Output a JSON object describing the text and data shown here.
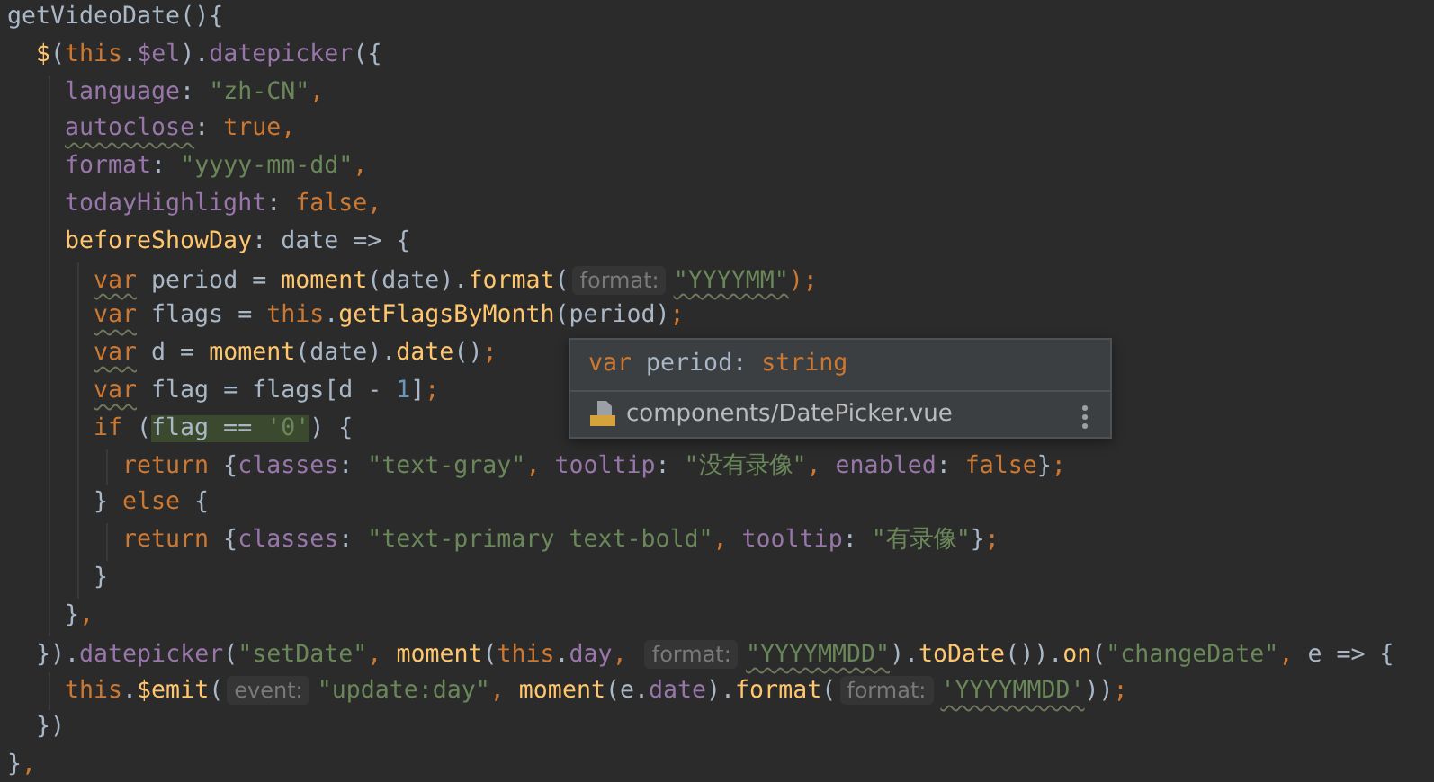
{
  "editor": {
    "lines": [
      {
        "tokens": [
          {
            "text": "getVideoDate(){",
            "kind": "plain"
          }
        ]
      },
      {
        "tokens": [
          {
            "text": "  $",
            "kind": "func"
          },
          {
            "text": "(",
            "kind": "plain"
          },
          {
            "text": "this",
            "kind": "keyword"
          },
          {
            "text": ".",
            "kind": "plain"
          },
          {
            "text": "$el",
            "kind": "prop"
          },
          {
            "text": ").",
            "kind": "plain"
          },
          {
            "text": "datepicker",
            "kind": "prop"
          },
          {
            "text": "({",
            "kind": "plain"
          }
        ]
      },
      {
        "tokens": [
          {
            "text": "    language",
            "kind": "prop"
          },
          {
            "text": ": ",
            "kind": "plain"
          },
          {
            "text": "\"zh-CN\"",
            "kind": "string"
          },
          {
            "text": ",",
            "kind": "separator"
          }
        ]
      },
      {
        "tokens": [
          {
            "text": "    autoclose",
            "kind": "prop-warned"
          },
          {
            "text": ": ",
            "kind": "plain"
          },
          {
            "text": "true",
            "kind": "keyword"
          },
          {
            "text": ",",
            "kind": "separator"
          }
        ]
      },
      {
        "tokens": [
          {
            "text": "    format",
            "kind": "prop"
          },
          {
            "text": ": ",
            "kind": "plain"
          },
          {
            "text": "\"yyyy-mm-dd\"",
            "kind": "string"
          },
          {
            "text": ",",
            "kind": "separator"
          }
        ]
      },
      {
        "tokens": [
          {
            "text": "    todayHighlight",
            "kind": "prop"
          },
          {
            "text": ": ",
            "kind": "plain"
          },
          {
            "text": "false",
            "kind": "keyword"
          },
          {
            "text": ",",
            "kind": "separator"
          }
        ]
      },
      {
        "tokens": [
          {
            "text": "    beforeShowDay",
            "kind": "func"
          },
          {
            "text": ": date => {",
            "kind": "plain"
          }
        ]
      },
      {
        "tokens": [
          {
            "text": "      var",
            "kind": "keyword-warned"
          },
          {
            "text": " period = ",
            "kind": "plain"
          },
          {
            "text": "moment",
            "kind": "func"
          },
          {
            "text": "(date).",
            "kind": "plain"
          },
          {
            "text": "format",
            "kind": "func"
          },
          {
            "text": "(",
            "kind": "plain"
          },
          {
            "text": "format:",
            "kind": "hint"
          },
          {
            "text": "\"YYYYMM\"",
            "kind": "string-warned"
          },
          {
            "text": ");",
            "kind": "separator"
          }
        ]
      },
      {
        "tokens": [
          {
            "text": "      var",
            "kind": "keyword-warned"
          },
          {
            "text": " flags = ",
            "kind": "plain"
          },
          {
            "text": "this",
            "kind": "keyword"
          },
          {
            "text": ".",
            "kind": "plain"
          },
          {
            "text": "getFlagsByMonth",
            "kind": "func"
          },
          {
            "text": "(period)",
            "kind": "plain"
          },
          {
            "text": ";",
            "kind": "separator"
          }
        ]
      },
      {
        "tokens": [
          {
            "text": "      var",
            "kind": "keyword-warned"
          },
          {
            "text": " d = ",
            "kind": "plain"
          },
          {
            "text": "moment",
            "kind": "func"
          },
          {
            "text": "(date).",
            "kind": "plain"
          },
          {
            "text": "date",
            "kind": "func"
          },
          {
            "text": "()",
            "kind": "plain"
          },
          {
            "text": ";",
            "kind": "separator"
          }
        ]
      },
      {
        "tokens": [
          {
            "text": "      var",
            "kind": "keyword-warned"
          },
          {
            "text": " flag = flags[d - ",
            "kind": "plain"
          },
          {
            "text": "1",
            "kind": "number"
          },
          {
            "text": "]",
            "kind": "plain"
          },
          {
            "text": ";",
            "kind": "separator"
          }
        ]
      },
      {
        "tokens": [
          {
            "text": "      if",
            "kind": "keyword"
          },
          {
            "text": " (",
            "kind": "plain"
          },
          {
            "text": "flag == ",
            "kind": "match"
          },
          {
            "text": "'0'",
            "kind": "match-string"
          },
          {
            "text": ") {",
            "kind": "plain"
          }
        ]
      },
      {
        "tokens": [
          {
            "text": "        return",
            "kind": "keyword"
          },
          {
            "text": " {",
            "kind": "plain"
          },
          {
            "text": "classes",
            "kind": "prop"
          },
          {
            "text": ": ",
            "kind": "plain"
          },
          {
            "text": "\"text-gray\"",
            "kind": "string"
          },
          {
            "text": ", ",
            "kind": "separator"
          },
          {
            "text": "tooltip",
            "kind": "prop"
          },
          {
            "text": ": ",
            "kind": "plain"
          },
          {
            "text": "\"没有录像\"",
            "kind": "string"
          },
          {
            "text": ", ",
            "kind": "separator"
          },
          {
            "text": "enabled",
            "kind": "prop"
          },
          {
            "text": ": ",
            "kind": "plain"
          },
          {
            "text": "false",
            "kind": "keyword"
          },
          {
            "text": "}",
            "kind": "plain"
          },
          {
            "text": ";",
            "kind": "separator"
          }
        ]
      },
      {
        "tokens": [
          {
            "text": "      } ",
            "kind": "plain"
          },
          {
            "text": "else",
            "kind": "keyword"
          },
          {
            "text": " {",
            "kind": "plain"
          }
        ]
      },
      {
        "tokens": [
          {
            "text": "        return",
            "kind": "keyword"
          },
          {
            "text": " {",
            "kind": "plain"
          },
          {
            "text": "classes",
            "kind": "prop"
          },
          {
            "text": ": ",
            "kind": "plain"
          },
          {
            "text": "\"text-primary text-bold\"",
            "kind": "string"
          },
          {
            "text": ", ",
            "kind": "separator"
          },
          {
            "text": "tooltip",
            "kind": "prop"
          },
          {
            "text": ": ",
            "kind": "plain"
          },
          {
            "text": "\"有录像\"",
            "kind": "string"
          },
          {
            "text": "}",
            "kind": "plain"
          },
          {
            "text": ";",
            "kind": "separator"
          }
        ]
      },
      {
        "tokens": [
          {
            "text": "      }",
            "kind": "plain"
          }
        ]
      },
      {
        "tokens": [
          {
            "text": "    }",
            "kind": "plain"
          },
          {
            "text": ",",
            "kind": "separator"
          }
        ]
      },
      {
        "tokens": [
          {
            "text": "  }).",
            "kind": "plain"
          },
          {
            "text": "datepicker",
            "kind": "prop"
          },
          {
            "text": "(",
            "kind": "plain"
          },
          {
            "text": "\"setDate\"",
            "kind": "string"
          },
          {
            "text": ", ",
            "kind": "separator"
          },
          {
            "text": "moment",
            "kind": "func"
          },
          {
            "text": "(",
            "kind": "plain"
          },
          {
            "text": "this",
            "kind": "keyword"
          },
          {
            "text": ".",
            "kind": "plain"
          },
          {
            "text": "day",
            "kind": "prop"
          },
          {
            "text": ", ",
            "kind": "separator"
          },
          {
            "text": "format:",
            "kind": "hint"
          },
          {
            "text": "\"YYYYMMDD\"",
            "kind": "string-warned"
          },
          {
            "text": ").",
            "kind": "plain"
          },
          {
            "text": "toDate",
            "kind": "func"
          },
          {
            "text": "()).",
            "kind": "plain"
          },
          {
            "text": "on",
            "kind": "func"
          },
          {
            "text": "(",
            "kind": "plain"
          },
          {
            "text": "\"changeDate\"",
            "kind": "string"
          },
          {
            "text": ", ",
            "kind": "separator"
          },
          {
            "text": "e => {",
            "kind": "plain"
          }
        ]
      },
      {
        "tokens": [
          {
            "text": "    this",
            "kind": "keyword"
          },
          {
            "text": ".",
            "kind": "plain"
          },
          {
            "text": "$emit",
            "kind": "func"
          },
          {
            "text": "(",
            "kind": "plain"
          },
          {
            "text": "event:",
            "kind": "hint"
          },
          {
            "text": "\"update:day\"",
            "kind": "string"
          },
          {
            "text": ", ",
            "kind": "separator"
          },
          {
            "text": "moment",
            "kind": "func"
          },
          {
            "text": "(e.",
            "kind": "plain"
          },
          {
            "text": "date",
            "kind": "prop"
          },
          {
            "text": ").",
            "kind": "plain"
          },
          {
            "text": "format",
            "kind": "func"
          },
          {
            "text": "(",
            "kind": "plain"
          },
          {
            "text": "format:",
            "kind": "hint"
          },
          {
            "text": "'YYYYMMDD'",
            "kind": "string-warned"
          },
          {
            "text": "))",
            "kind": "plain"
          },
          {
            "text": ";",
            "kind": "separator"
          }
        ]
      },
      {
        "tokens": [
          {
            "text": "  })",
            "kind": "plain"
          }
        ]
      },
      {
        "tokens": [
          {
            "text": "}",
            "kind": "plain"
          },
          {
            "text": ",",
            "kind": "separator"
          }
        ]
      }
    ]
  },
  "popup": {
    "signature": [
      {
        "text": "var",
        "kind": "keyword"
      },
      {
        "text": " period: ",
        "kind": "plain"
      },
      {
        "text": "string",
        "kind": "keyword"
      }
    ],
    "file": "components/DatePicker.vue"
  }
}
